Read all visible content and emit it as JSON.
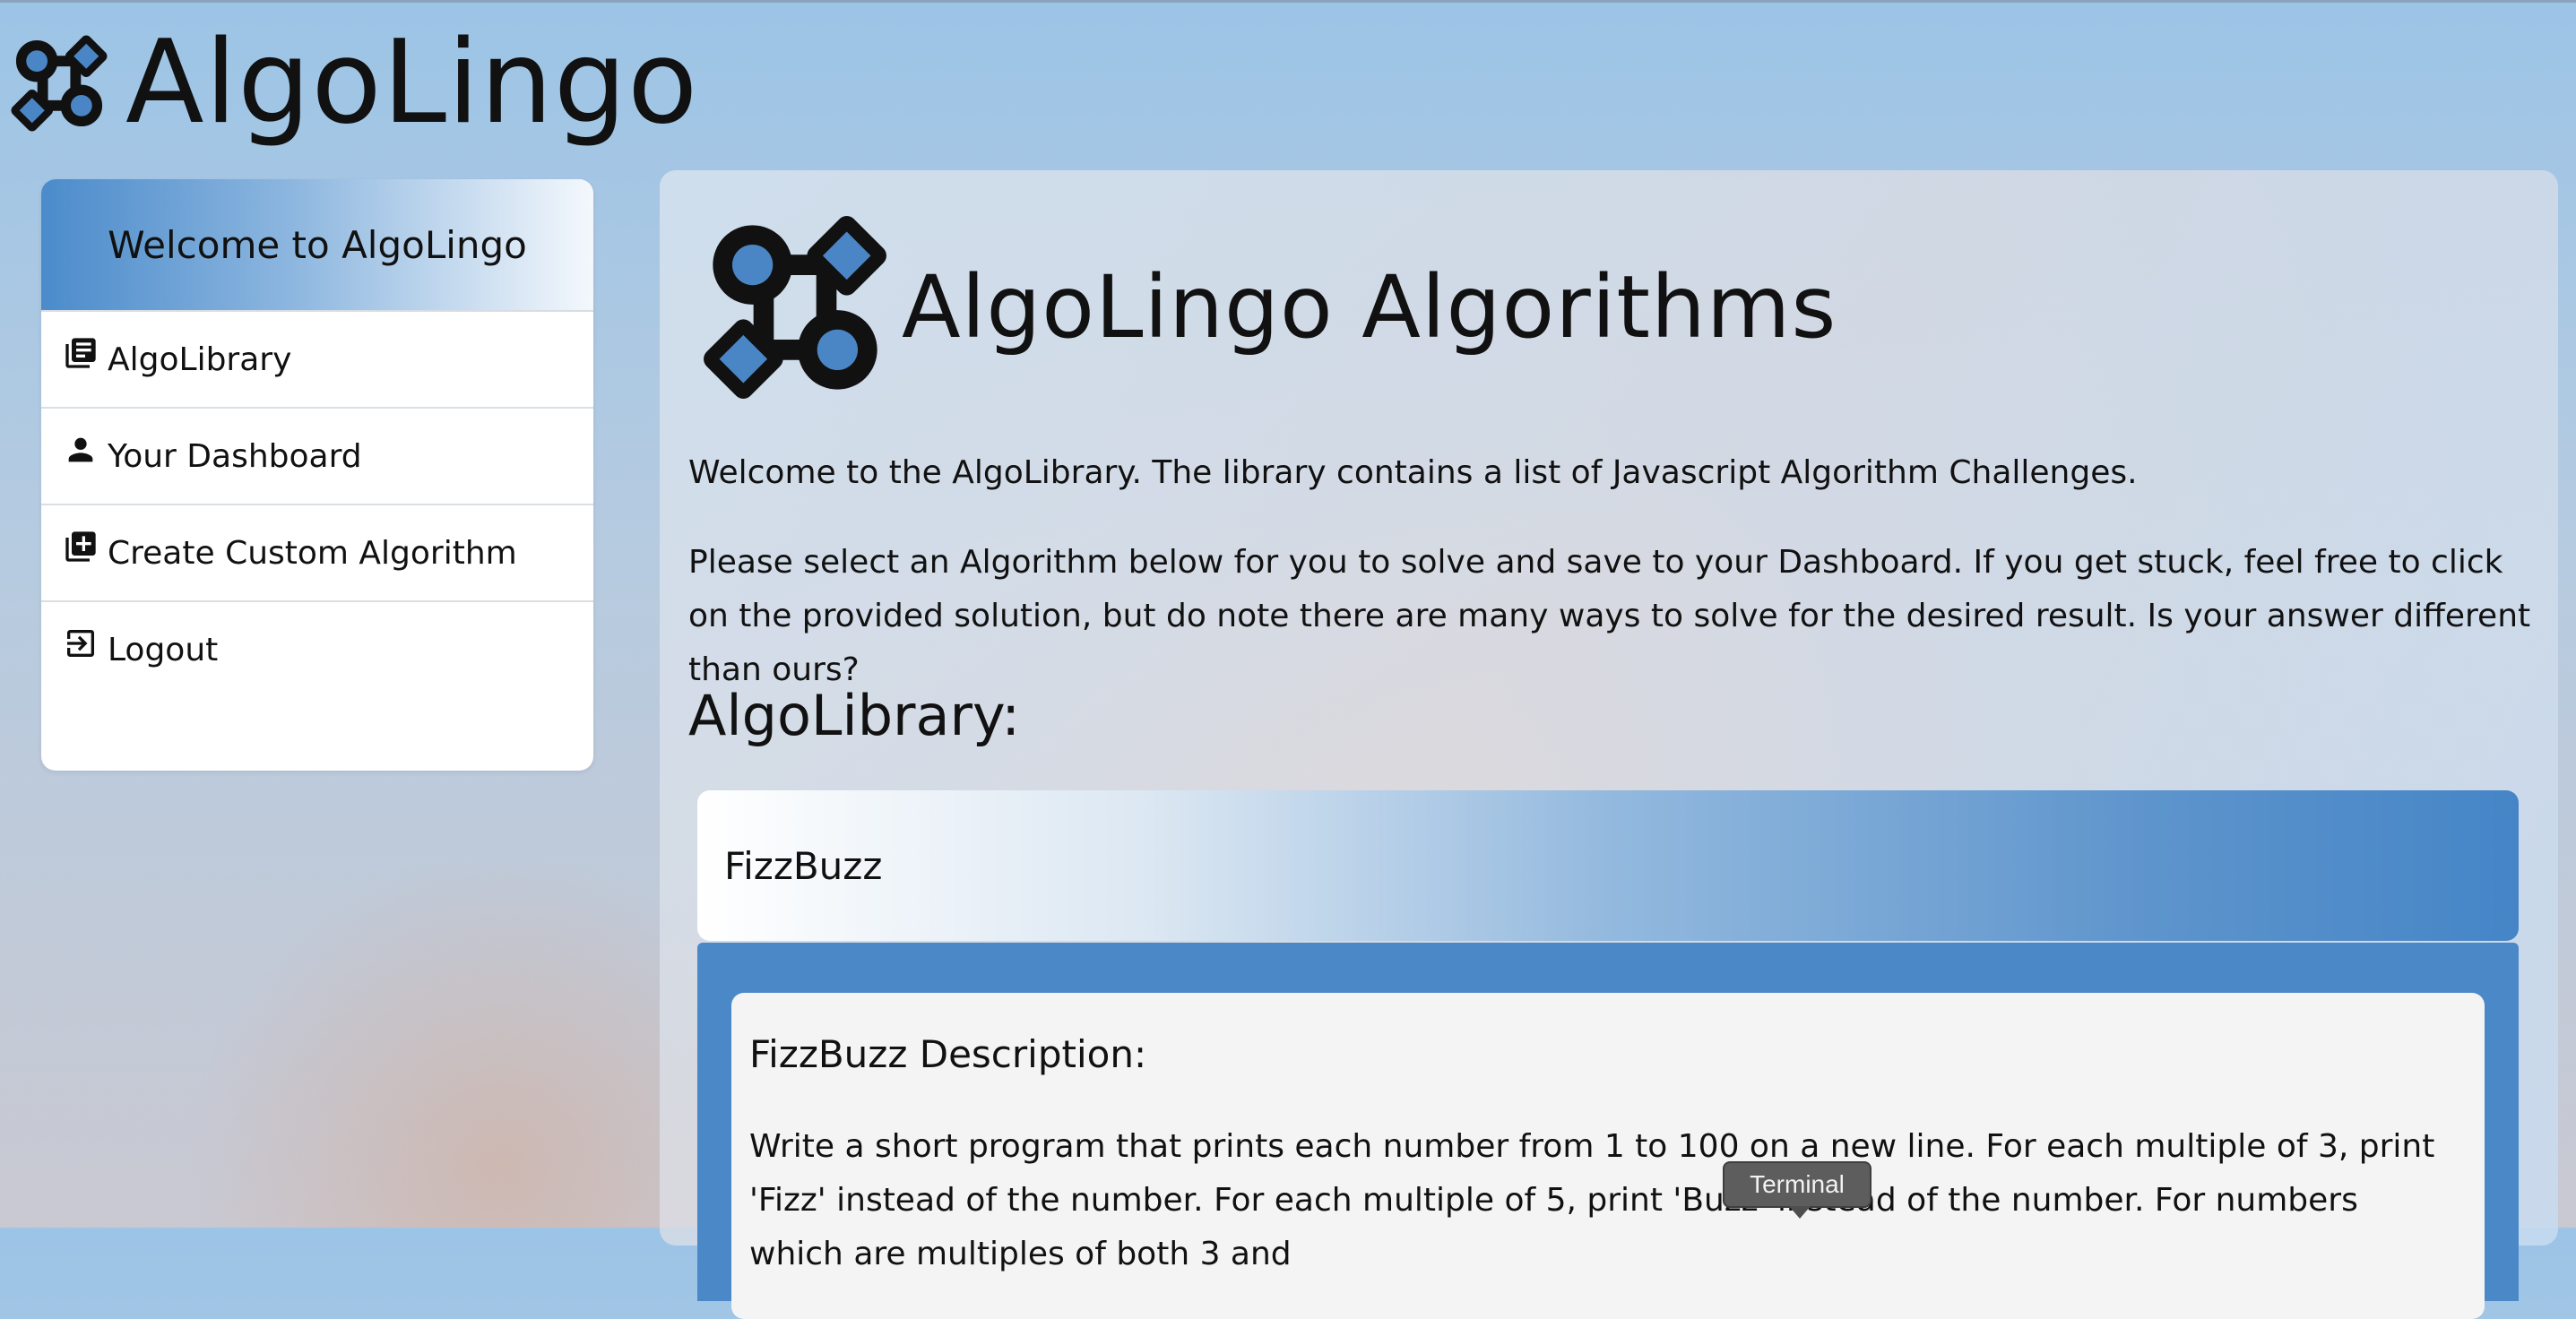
{
  "brand": {
    "name": "AlgoLingo",
    "logo_icon": "algolingo-logo-icon"
  },
  "sidebar": {
    "header": "Welcome to AlgoLingo",
    "items": [
      {
        "label": "AlgoLibrary",
        "icon": "library-books-icon"
      },
      {
        "label": "Your Dashboard",
        "icon": "person-icon"
      },
      {
        "label": "Create Custom Algorithm",
        "icon": "add-box-icon"
      },
      {
        "label": "Logout",
        "icon": "logout-icon"
      }
    ]
  },
  "main": {
    "title": "AlgoLingo Algorithms",
    "intro1": "Welcome to the AlgoLibrary. The library contains a list of Javascript Algorithm Challenges.",
    "intro2": "Please select an Algorithm below for you to solve and save to your Dashboard. If you get stuck, feel free to click on the provided solution, but do note there are many ways to solve for the desired result. Is your answer different than ours?",
    "section_heading": "AlgoLibrary:",
    "algorithms": [
      {
        "name": "FizzBuzz",
        "description_title": "FizzBuzz Description:",
        "description": "Write a short program that prints each number from 1 to 100 on a new line. For each multiple of 3, print 'Fizz' instead of the number. For each multiple of 5, print 'Buzz' instead of the number. For numbers which are multiples of both 3 and"
      }
    ]
  },
  "tooltip": {
    "text": "Terminal"
  },
  "colors": {
    "accent_blue": "#4a88c7",
    "logo_blue": "#4a86c5",
    "tooltip_bg": "#5d5d5d"
  }
}
